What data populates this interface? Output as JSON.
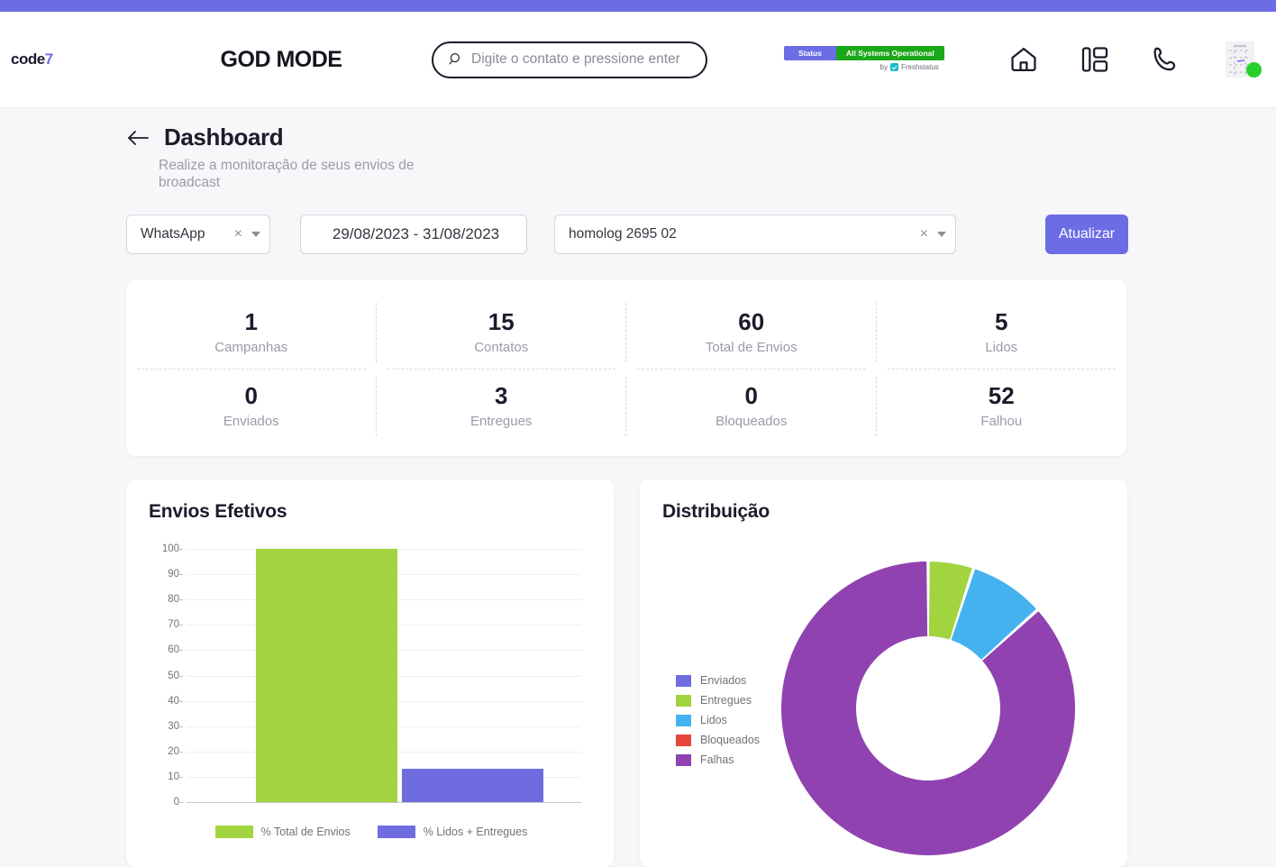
{
  "colors": {
    "accent": "#6c6ce5",
    "green": "#a2d43f",
    "blue": "#45b2f0",
    "red": "#e8453c",
    "purple_slice": "#9043b0",
    "status_green": "#1aa81a",
    "online": "#25d02b"
  },
  "header": {
    "logo_text": "code",
    "logo_suffix": "7",
    "app_title": "GOD MODE",
    "search": {
      "placeholder": "Digite o contato e pressione enter",
      "value": "",
      "icon": "search-icon"
    },
    "status": {
      "label": "Status",
      "message": "All Systems Operational",
      "by_prefix": "by",
      "by_brand": "Freshstatus"
    },
    "icons": [
      "home-icon",
      "layout-dashboard-icon",
      "phone-icon",
      "avatar"
    ]
  },
  "page": {
    "back_label": "back-arrow",
    "title": "Dashboard",
    "subtitle": "Realize a monitoração de seus envios de broadcast"
  },
  "filters": {
    "channel": {
      "value": "WhatsApp",
      "clear": "×"
    },
    "date_range": {
      "value": "29/08/2023 - 31/08/2023"
    },
    "campaign": {
      "value": "homolog 2695 02",
      "clear": "×"
    },
    "update_button": "Atualizar"
  },
  "stats": [
    {
      "value": "1",
      "label": "Campanhas"
    },
    {
      "value": "15",
      "label": "Contatos"
    },
    {
      "value": "60",
      "label": "Total de Envios"
    },
    {
      "value": "5",
      "label": "Lidos"
    },
    {
      "value": "0",
      "label": "Enviados"
    },
    {
      "value": "3",
      "label": "Entregues"
    },
    {
      "value": "0",
      "label": "Bloqueados"
    },
    {
      "value": "52",
      "label": "Falhou"
    }
  ],
  "charts": {
    "bar_title": "Envios Efetivos",
    "donut_title": "Distribuição"
  },
  "chart_data": [
    {
      "type": "bar",
      "title": "Envios Efetivos",
      "categories": [
        "% Total de Envios",
        "% Lidos + Entregues"
      ],
      "values": [
        100,
        13.3
      ],
      "colors": [
        "#a2d43f",
        "#6f6ce0"
      ],
      "legend": [
        "% Total de Envios",
        "% Lidos + Entregues"
      ],
      "legend_position": "bottom",
      "ylabel": "",
      "xlabel": "",
      "ylim": [
        0,
        100
      ],
      "yticks": [
        0,
        10,
        20,
        30,
        40,
        50,
        60,
        70,
        80,
        90,
        100
      ],
      "grid": true
    },
    {
      "type": "pie",
      "subtype": "donut",
      "title": "Distribuição",
      "labels": [
        "Enviados",
        "Entregues",
        "Lidos",
        "Bloqueados",
        "Falhas"
      ],
      "values": [
        0,
        3,
        5,
        0,
        52
      ],
      "colors": [
        "#6f6ce0",
        "#a2d43f",
        "#45b2f0",
        "#e8453c",
        "#9043b0"
      ],
      "legend": [
        "Enviados",
        "Entregues",
        "Lidos",
        "Bloqueados",
        "Falhas"
      ],
      "legend_position": "left",
      "total": 60
    }
  ]
}
